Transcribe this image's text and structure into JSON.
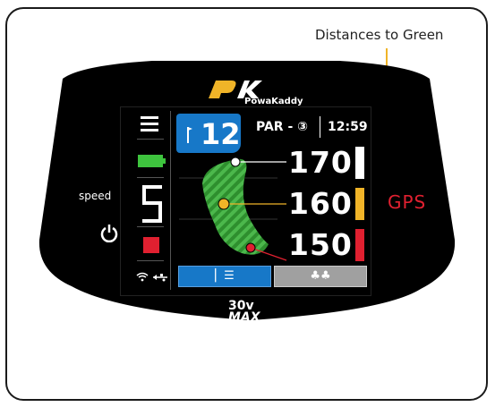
{
  "callout": {
    "label": "Distances to Green"
  },
  "logo": {
    "brand_sub": "PowaKaddy"
  },
  "sidebar": {
    "speed_label": "speed",
    "speed_value": "5"
  },
  "hole": {
    "number": "12",
    "par": "PAR - ③",
    "time": "12:59"
  },
  "distances": {
    "back": "170",
    "middle": "160",
    "front": "150"
  },
  "gps_label": "GPS",
  "tabs": {
    "left": "▏☰",
    "right": "♣♣"
  },
  "brand_bottom": {
    "line1": "30v",
    "line2": "MAX"
  },
  "colors": {
    "accent_blue": "#1778c8",
    "green": "#3aa83a",
    "battery": "#3ec43e",
    "stop": "#e02030",
    "gold": "#f0b428",
    "back_bar": "#ffffff",
    "middle_bar": "#f0b428",
    "front_bar": "#e02030"
  }
}
